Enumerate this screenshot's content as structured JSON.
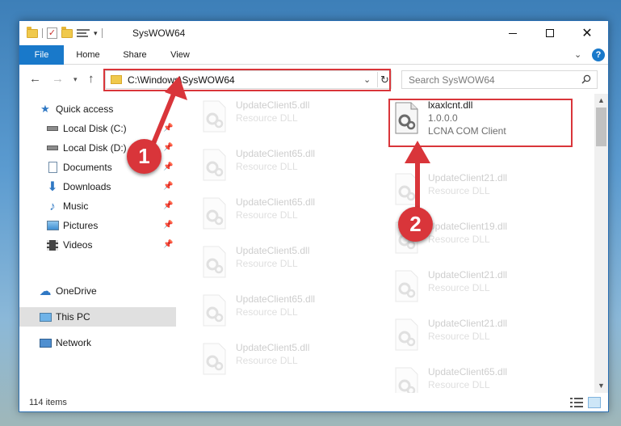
{
  "window": {
    "title": "SysWOW64"
  },
  "window_controls": {
    "minimize": "–",
    "maximize": "□",
    "close": "✕"
  },
  "ribbon": {
    "tabs": [
      "File",
      "Home",
      "Share",
      "View"
    ],
    "help": "?"
  },
  "address": {
    "path": "C:\\Windows\\SysWOW64"
  },
  "search": {
    "placeholder": "Search SysWOW64"
  },
  "nav_pane": {
    "items": [
      {
        "label": "Quick access",
        "icon": "star-icon",
        "pinned": false
      },
      {
        "label": "Local Disk (C:)",
        "icon": "drive-icon",
        "pinned": true
      },
      {
        "label": "Local Disk (D:)",
        "icon": "drive-icon",
        "pinned": true
      },
      {
        "label": "Documents",
        "icon": "documents-icon",
        "pinned": true
      },
      {
        "label": "Downloads",
        "icon": "download-arrow-icon",
        "pinned": true
      },
      {
        "label": "Music",
        "icon": "music-note-icon",
        "pinned": true
      },
      {
        "label": "Pictures",
        "icon": "pictures-icon",
        "pinned": true
      },
      {
        "label": "Videos",
        "icon": "film-icon",
        "pinned": true
      },
      {
        "label": "OneDrive",
        "icon": "cloud-icon",
        "pinned": false
      },
      {
        "label": "This PC",
        "icon": "monitor-icon",
        "pinned": false,
        "selected": true
      },
      {
        "label": "Network",
        "icon": "network-icon",
        "pinned": false
      }
    ]
  },
  "highlighted_file": {
    "name": "lxaxlcnt.dll",
    "version": "1.0.0.0",
    "description": "LCNA COM Client"
  },
  "files_left": [
    {
      "name": "UpdateClient5.dll",
      "type": "Resource DLL"
    },
    {
      "name": "UpdateClient65.dll",
      "type": "Resource DLL"
    },
    {
      "name": "UpdateClient65.dll",
      "type": "Resource DLL"
    },
    {
      "name": "UpdateClient5.dll",
      "type": "Resource DLL"
    },
    {
      "name": "UpdateClient65.dll",
      "type": "Resource DLL"
    },
    {
      "name": "UpdateClient5.dll",
      "type": "Resource DLL"
    }
  ],
  "files_right": [
    {
      "name": "UpdateClient21.dll",
      "type": "Resource DLL"
    },
    {
      "name": "UpdateClient19.dll",
      "type": "Resource DLL"
    },
    {
      "name": "UpdateClient21.dll",
      "type": "Resource DLL"
    },
    {
      "name": "UpdateClient21.dll",
      "type": "Resource DLL"
    },
    {
      "name": "UpdateClient65.dll",
      "type": "Resource DLL"
    }
  ],
  "status": {
    "item_count": "114 items"
  },
  "annotations": {
    "step1": "1",
    "step2": "2"
  },
  "colors": {
    "accent": "#1979ca",
    "annotation": "#d9353a"
  }
}
